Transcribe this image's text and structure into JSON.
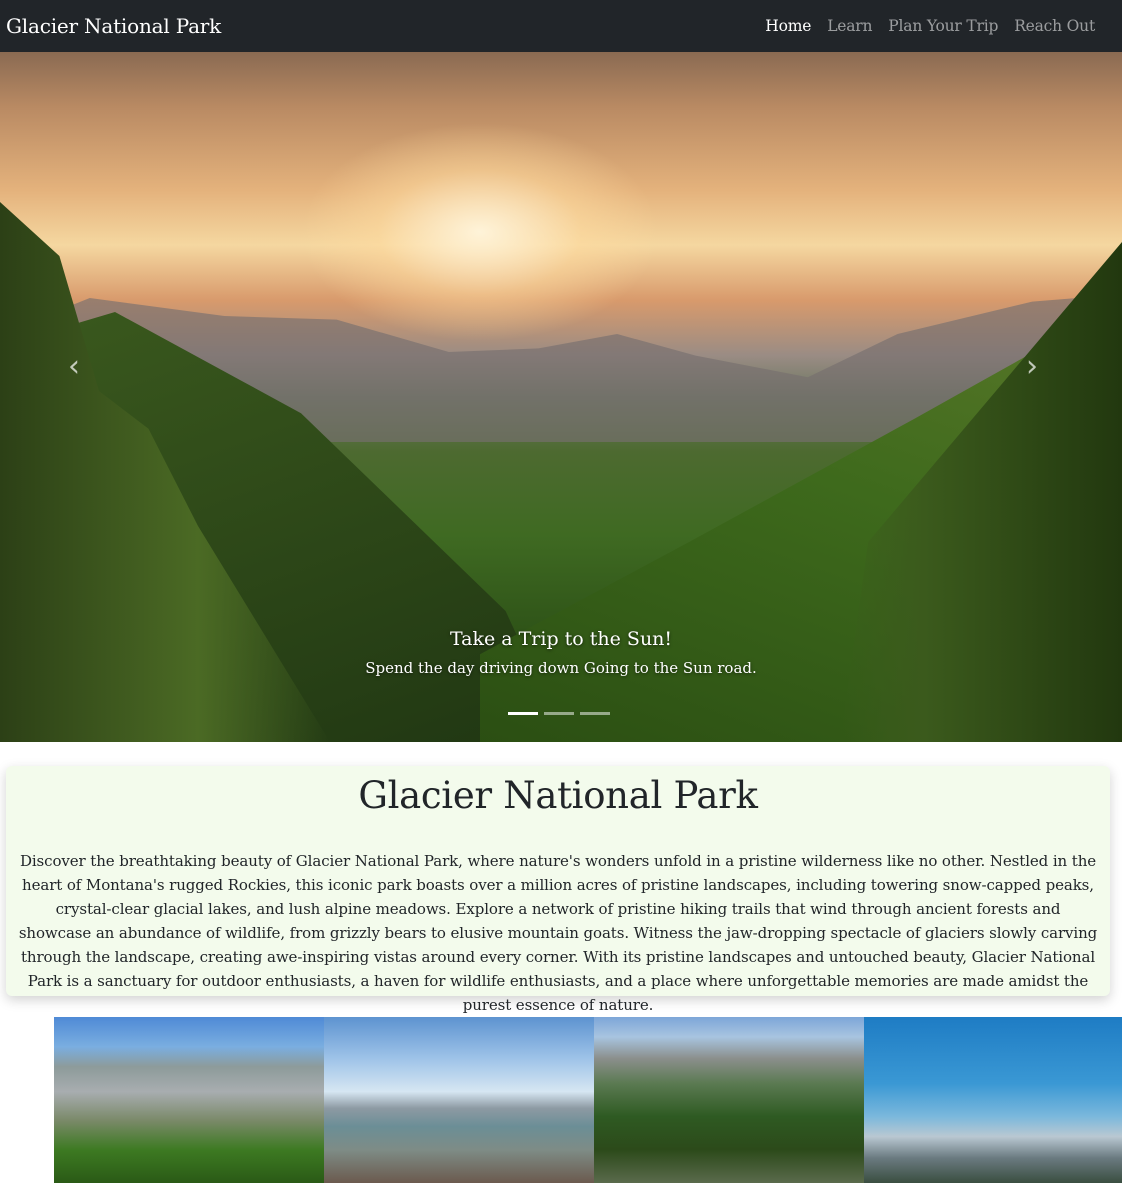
{
  "navbar": {
    "brand": "Glacier National Park",
    "links": [
      {
        "label": "Home",
        "active": true
      },
      {
        "label": "Learn",
        "active": false
      },
      {
        "label": "Plan Your Trip",
        "active": false
      },
      {
        "label": "Reach Out",
        "active": false
      }
    ]
  },
  "carousel": {
    "prev_icon": "chevron-left-icon",
    "next_icon": "chevron-right-icon",
    "prev_glyph": "‹",
    "next_glyph": "›",
    "caption_title": "Take a Trip to the Sun!",
    "caption_text": "Spend the day driving down Going to the Sun road.",
    "slide_count": 3,
    "active_slide": 1
  },
  "intro": {
    "title": "Glacier National Park",
    "text": "Discover the breathtaking beauty of Glacier National Park, where nature's wonders unfold in a pristine wilderness like no other. Nestled in the heart of Montana's rugged Rockies, this iconic park boasts over a million acres of pristine landscapes, including towering snow-capped peaks, crystal-clear glacial lakes, and lush alpine meadows. Explore a network of pristine hiking trails that wind through ancient forests and showcase an abundance of wildlife, from grizzly bears to elusive mountain goats. Witness the jaw-dropping spectacle of glaciers slowly carving through the landscape, creating awe-inspiring vistas around every corner. With its pristine landscapes and untouched beauty, Glacier National Park is a sanctuary for outdoor enthusiasts, a haven for wildlife enthusiasts, and a place where unforgettable memories are made amidst the purest essence of nature."
  },
  "colors": {
    "navbar_bg": "#212529",
    "intro_bg": "#f3fbec"
  }
}
